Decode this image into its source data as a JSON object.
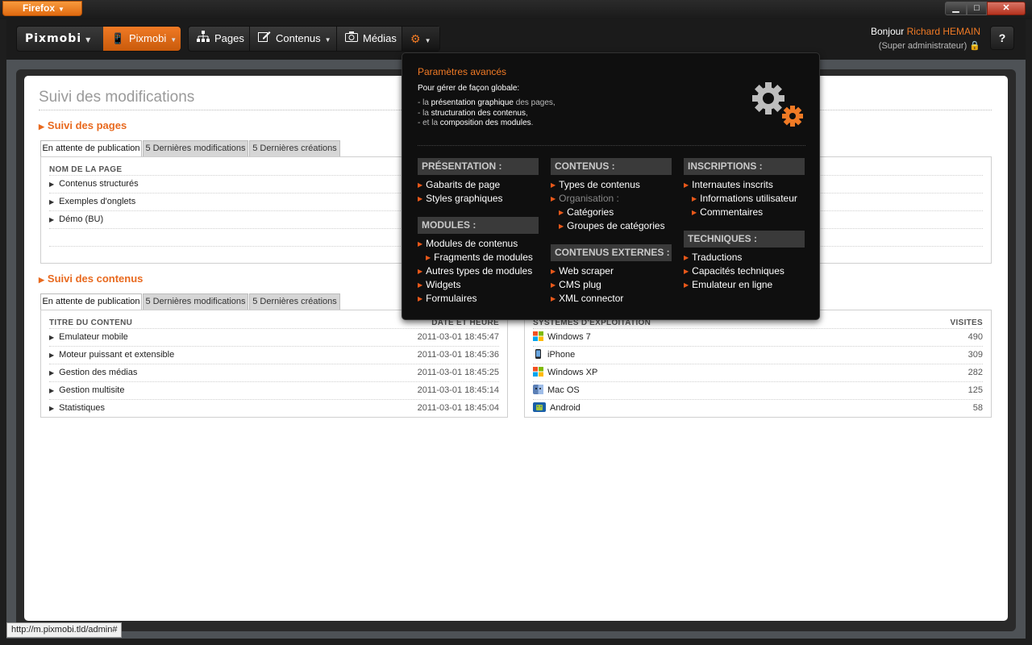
{
  "browser": {
    "app_button": "Firefox",
    "minimize": "▁",
    "maximize": "□",
    "close": "✕"
  },
  "nav": {
    "logo": "Pixmobi",
    "site": "Pixmobi",
    "pages": "Pages",
    "contenus": "Contenus",
    "medias": "Médias",
    "greeting_prefix": "Bonjour ",
    "user_name": "Richard HEMAIN",
    "role": "(Super administrateur)",
    "help": "?"
  },
  "page": {
    "title": "Suivi des modifications",
    "pages_section": {
      "title": "Suivi des pages",
      "tabs": [
        "En attente de publication",
        "5 Dernières modifications",
        "5 Dernières créations"
      ],
      "column": "NOM DE LA PAGE",
      "rows": [
        "Contenus structurés",
        "Exemples d'onglets",
        "Démo (BU)"
      ]
    },
    "contents_section": {
      "title": "Suivi des contenus",
      "tabs": [
        "En attente de publication",
        "5 Dernières modifications",
        "5 Dernières créations"
      ],
      "columns": [
        "TITRE DU CONTENU",
        "DATE ET HEURE"
      ],
      "rows": [
        {
          "title": "Emulateur mobile",
          "date": "2011-03-01 18:45:47"
        },
        {
          "title": "Moteur puissant et extensible",
          "date": "2011-03-01 18:45:36"
        },
        {
          "title": "Gestion des médias",
          "date": "2011-03-01 18:45:25"
        },
        {
          "title": "Gestion multisite",
          "date": "2011-03-01 18:45:14"
        },
        {
          "title": "Statistiques",
          "date": "2011-03-01 18:45:04"
        }
      ]
    },
    "os_panel": {
      "columns": [
        "SYSTÈMES D'EXPLOITATION",
        "VISITES"
      ],
      "rows": [
        {
          "name": "Windows 7",
          "visits": "490",
          "icon": "windows-icon"
        },
        {
          "name": "iPhone",
          "visits": "309",
          "icon": "iphone-icon"
        },
        {
          "name": "Windows XP",
          "visits": "282",
          "icon": "windows-icon"
        },
        {
          "name": "Mac OS",
          "visits": "125",
          "icon": "macos-icon"
        },
        {
          "name": "Android",
          "visits": "58",
          "icon": "android-icon"
        }
      ]
    }
  },
  "dropdown": {
    "title": "Paramètres avancés",
    "intro": "Pour gérer de façon globale:",
    "lines": [
      {
        "pre": "- la ",
        "bold": "présentation graphique",
        "post": " des pages,"
      },
      {
        "pre": "- la ",
        "bold": "structuration des contenus",
        "post": ","
      },
      {
        "pre": "- et la ",
        "bold": "composition des modules",
        "post": "."
      }
    ],
    "columns": {
      "presentation": {
        "head": "PRÉSENTATION :",
        "links": [
          "Gabarits de page",
          "Styles graphiques"
        ]
      },
      "modules": {
        "head": "MODULES :",
        "links": [
          "Modules de contenus",
          "Fragments de modules",
          "Autres types de modules",
          "Widgets",
          "Formulaires"
        ]
      },
      "contenus": {
        "head": "CONTENUS :",
        "links": [
          "Types de contenus",
          "Organisation :",
          "Catégories",
          "Groupes de catégories"
        ]
      },
      "contenus_externes": {
        "head": "CONTENUS EXTERNES :",
        "links": [
          "Web scraper",
          "CMS plug",
          "XML connector"
        ]
      },
      "inscriptions": {
        "head": "INSCRIPTIONS :",
        "links": [
          "Internautes inscrits",
          "Informations utilisateur",
          "Commentaires"
        ]
      },
      "techniques": {
        "head": "TECHNIQUES :",
        "links": [
          "Traductions",
          "Capacités techniques",
          "Emulateur en ligne"
        ]
      }
    }
  },
  "statusbar": "http://m.pixmobi.tld/admin#",
  "colors": {
    "accent": "#f07a25",
    "dark": "#0f0f0f"
  }
}
